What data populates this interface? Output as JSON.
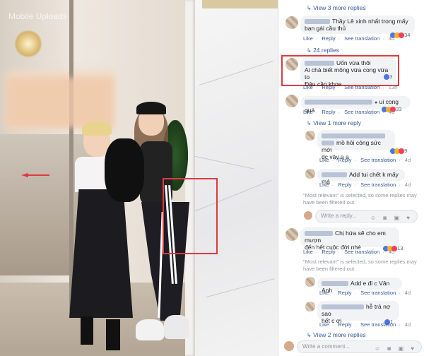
{
  "photo": {
    "watermark": "Mobile Uploads",
    "top_sign": "",
    "colors": {
      "highlight_box": "#e0393e"
    }
  },
  "comments": {
    "view_more_top": "View 3 more replies",
    "c1": {
      "text": "Thầy Lê xinh nhất trong mấy bạn gái cầu thủ",
      "like": "Like",
      "reply": "Reply",
      "see_translation": "See translation",
      "time": "4d",
      "reactions": "34"
    },
    "replies_count": "24 replies",
    "c2": {
      "line1": "Uốn vừa thôi",
      "line2": "Ai chả biết mông vừa cong vừa to",
      "line3": "Đâu cần khoe",
      "like": "Like",
      "reply": "Reply",
      "see_translation": "See translation",
      "time": "13h",
      "reactions": "3"
    },
    "c3": {
      "text": "ui cong quá",
      "like": "Like",
      "reply": "Reply",
      "see_translation": "See translation",
      "time": "4d",
      "reactions": "33"
    },
    "view_more_mid": "View 1 more reply",
    "r1": {
      "text_line1": "mồ hôi công sức mới",
      "text_line2": "dc vậy a ạ",
      "like": "Like",
      "reply": "Reply",
      "see_translation": "See translation",
      "time": "4d",
      "reactions": "9"
    },
    "r2": {
      "text": "Add tui chết k mấy má",
      "like": "Like",
      "reply": "Reply",
      "see_translation": "See translation",
      "time": "4d"
    },
    "notice1": {
      "line1": "\"Most relevant\" is selected, so some replies may",
      "line2": "have been filtered out."
    },
    "write_reply": "Write a reply...",
    "c4": {
      "line1": "Chị hứa sẽ cho em mượn",
      "line2": "đến hết cuộc đời nhé",
      "like": "Like",
      "reply": "Reply",
      "see_translation": "See translation",
      "time": "4d",
      "reactions": "13"
    },
    "notice2": {
      "line1": "\"Most relevant\" is selected, so some replies may",
      "line2": "have been filtered out."
    },
    "r3": {
      "text": "Add e đi c Vân Anh",
      "like": "Like",
      "reply": "Reply",
      "see_translation": "See translation",
      "time": "4d"
    },
    "r4": {
      "line1": "hễ trả nợ sao",
      "line2": "hết c ơi",
      "like": "Like",
      "reply": "Reply",
      "see_translation": "See translation",
      "time": "4d",
      "reactions": "1"
    },
    "view_more_bottom": "View 2 more replies",
    "write_comment": "Write a comment..."
  }
}
